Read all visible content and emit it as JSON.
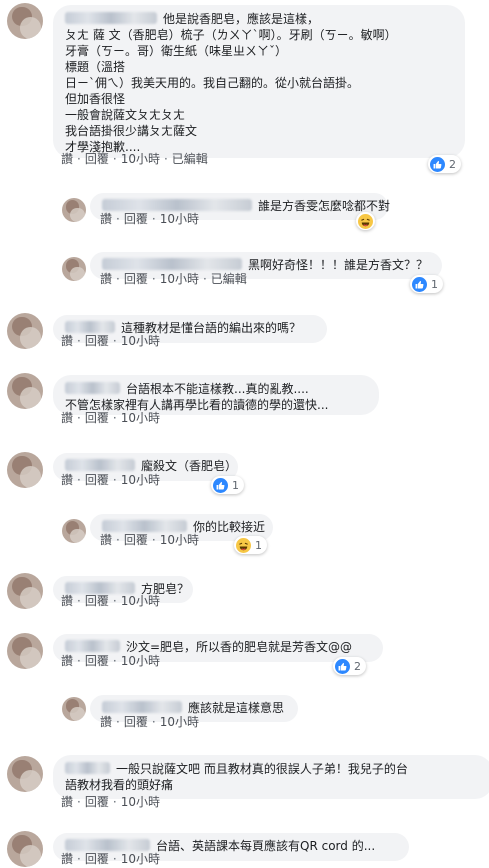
{
  "labels": {
    "like": "讚",
    "reply": "回覆",
    "edited": "已編輯"
  },
  "comments": [
    {
      "id": "c1",
      "lines": [
        "他是說香肥皂，應該是這樣，",
        "ㄆㄤ 薩 文（香肥皂）梳子（ㄌㄨㄚˋ啊）。牙刷（ㄎㄧ。敏啊）",
        "牙膏（ㄎㄧ。哥）衛生紙（味星ㄓㄨㄚˇ）",
        "標題（溫搭",
        "日ㄧ`佣ㄟ）我美天用的。我自己翻的。從小就台語掛。",
        "但加香很怪",
        "一般會說薩文ㄆㄤㄆㄤ",
        "我台語掛很少講ㄆㄤ薩文",
        "才學淺抱歉...."
      ],
      "time": "10小時",
      "edited": true,
      "reaction": {
        "type": "like",
        "count": "2"
      }
    },
    {
      "id": "c1r1",
      "lines": [
        "誰是方香雯怎麼唸都不對"
      ],
      "time": "10小時",
      "edited": false,
      "reaction": {
        "type": "haha",
        "count": ""
      }
    },
    {
      "id": "c1r2",
      "lines": [
        "黑啊好奇怪！！！誰是方香文？？"
      ],
      "time": "10小時",
      "edited": true,
      "reaction": {
        "type": "like",
        "count": "1"
      }
    },
    {
      "id": "c2",
      "lines": [
        "這種教材是懂台語的編出來的嗎？"
      ],
      "time": "10小時",
      "edited": false,
      "reaction": null
    },
    {
      "id": "c3",
      "lines": [
        "台語根本不能這樣教...真的亂教....",
        "不管怎樣家裡有人講再學比看的讀德的學的還快..."
      ],
      "time": "10小時",
      "edited": false,
      "reaction": null
    },
    {
      "id": "c4",
      "lines": [
        "龐殺文（香肥皂）"
      ],
      "time": "10小時",
      "edited": false,
      "reaction": {
        "type": "like",
        "count": "1"
      }
    },
    {
      "id": "c4r1",
      "lines": [
        "你的比較接近"
      ],
      "time": "10小時",
      "edited": false,
      "reaction": {
        "type": "haha",
        "count": "1"
      }
    },
    {
      "id": "c5",
      "lines": [
        "方肥皂？"
      ],
      "time": "10小時",
      "edited": false,
      "reaction": null
    },
    {
      "id": "c6",
      "lines": [
        "沙文=肥皂，所以香的肥皂就是芳香文@@"
      ],
      "time": "10小時",
      "edited": false,
      "reaction": {
        "type": "like",
        "count": "2"
      }
    },
    {
      "id": "c6r1",
      "lines": [
        "應該就是這樣意思"
      ],
      "time": "10小時",
      "edited": false,
      "reaction": null
    },
    {
      "id": "c7",
      "lines": [
        "一般只說薩文吧 而且教材真的很誤人子弟！我兒子的台",
        "語教材我看的頭好痛"
      ],
      "time": "10小時",
      "edited": false,
      "reaction": null
    },
    {
      "id": "c8",
      "lines": [
        "台語、英語課本每頁應該有QR cord 的..."
      ],
      "time": "10小時",
      "edited": false,
      "reaction": null
    }
  ]
}
